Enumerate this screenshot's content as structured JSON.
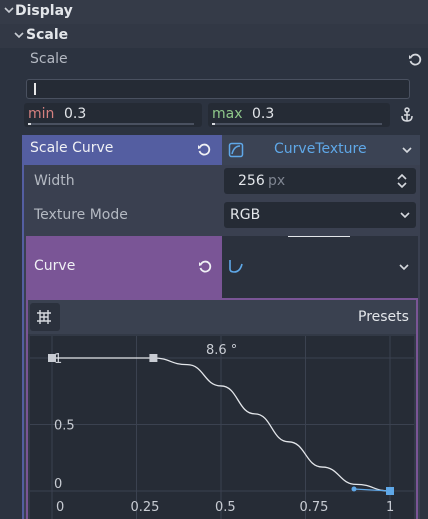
{
  "sections": {
    "display": "Display",
    "scale": "Scale"
  },
  "scale_field": {
    "label": "Scale",
    "min_label": "min",
    "min_value": "0.3",
    "max_label": "max",
    "max_value": "0.3"
  },
  "scale_curve": {
    "label": "Scale Curve",
    "resource": "CurveTexture"
  },
  "width": {
    "label": "Width",
    "value": "256",
    "unit": "px"
  },
  "texture_mode": {
    "label": "Texture Mode",
    "value": "RGB"
  },
  "curve": {
    "label": "Curve"
  },
  "curve_editor": {
    "presets_label": "Presets",
    "angle_label": "8.6 °",
    "y_labels": [
      "1",
      "0.5",
      "0"
    ],
    "x_labels": [
      "0",
      "0.25",
      "0.5",
      "0.75",
      "1"
    ]
  },
  "chart_data": {
    "type": "line",
    "title": "",
    "xlabel": "",
    "ylabel": "",
    "xlim": [
      0,
      1
    ],
    "ylim": [
      0,
      1
    ],
    "grid": true,
    "points": [
      {
        "x": 0,
        "y": 1
      },
      {
        "x": 0.3,
        "y": 1
      },
      {
        "x": 1,
        "y": 0
      }
    ],
    "series": [
      {
        "x": [
          0,
          0.3,
          0.4,
          0.5,
          0.6,
          0.7,
          0.8,
          0.9,
          1
        ],
        "y": [
          1,
          1,
          0.95,
          0.79,
          0.58,
          0.37,
          0.18,
          0.05,
          0
        ]
      }
    ]
  },
  "colors": {
    "scale_curve_header": "#545ea1",
    "curve_header": "#7a5596",
    "accent_blue": "#5fa8e8",
    "min_red": "#d5807f",
    "max_green": "#8fc88a"
  }
}
